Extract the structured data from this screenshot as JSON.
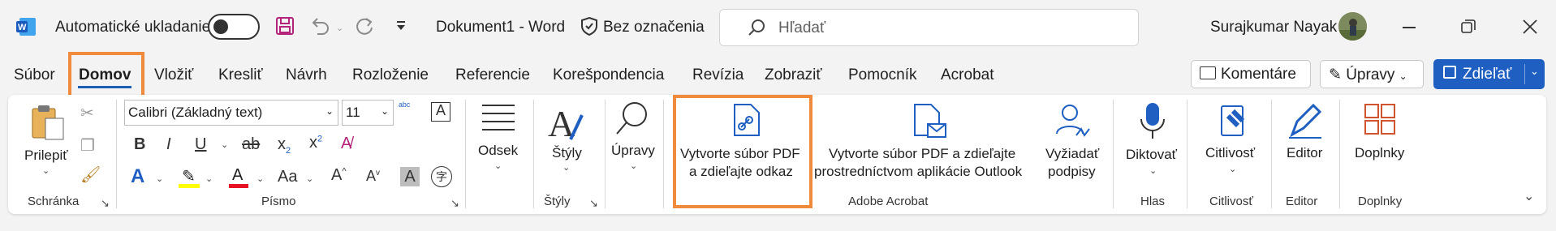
{
  "titlebar": {
    "app_icon": "word-icon",
    "autosave_label": "Automatické ukladanie",
    "document_title": "Dokument1 - Word",
    "sensitivity_label": "Bez označenia",
    "search_placeholder": "Hľadať",
    "user_name": "Surajkumar Nayak"
  },
  "tabs": [
    "Súbor",
    "Domov",
    "Vložiť",
    "Kresliť",
    "Návrh",
    "Rozloženie",
    "Referencie",
    "Korešpondencia",
    "Revízia",
    "Zobraziť",
    "Pomocník",
    "Acrobat"
  ],
  "actions": {
    "comments": "Komentáre",
    "editing": "Úpravy",
    "share": "Zdieľať"
  },
  "ribbon": {
    "clipboard": {
      "paste": "Prilepiť",
      "group": "Schránka"
    },
    "font": {
      "name": "Calibri (Základný text)",
      "size": "11",
      "group": "Písmo"
    },
    "paragraph": {
      "label": "Odsek"
    },
    "styles": {
      "label": "Štýly",
      "group": "Štýly"
    },
    "editing": {
      "label": "Úpravy"
    },
    "acrobat": {
      "create_link_line1": "Vytvorte súbor PDF",
      "create_link_line2": "a zdieľajte odkaz",
      "create_outlook_line1": "Vytvorte súbor PDF a zdieľajte",
      "create_outlook_line2": "prostredníctvom aplikácie Outlook",
      "request_line1": "Vyžiadať",
      "request_line2": "podpisy",
      "group": "Adobe Acrobat"
    },
    "voice": {
      "label": "Diktovať",
      "group": "Hlas"
    },
    "sensitivity": {
      "label": "Citlivosť",
      "group": "Citlivosť"
    },
    "editor": {
      "label": "Editor",
      "group": "Editor"
    },
    "addins": {
      "label": "Doplnky",
      "group": "Doplnky"
    }
  },
  "colors": {
    "accent": "#1f5fc1",
    "highlight_box": "#f08a3c",
    "font_color": "#e81123",
    "highlight_color": "#ffff00"
  }
}
